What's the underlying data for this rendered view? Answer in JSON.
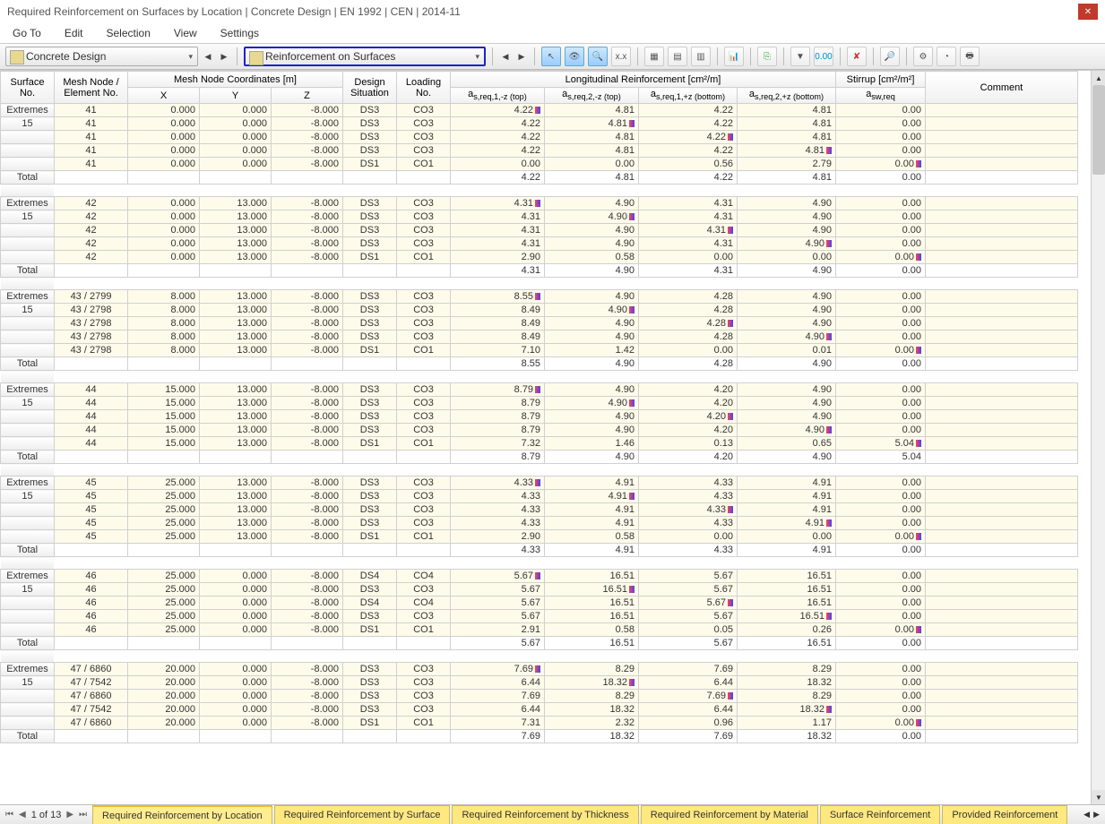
{
  "title": "Required Reinforcement on Surfaces by Location | Concrete Design | EN 1992 | CEN | 2014-11",
  "menu": [
    "Go To",
    "Edit",
    "Selection",
    "View",
    "Settings"
  ],
  "combo1": "Concrete Design",
  "combo2": "Reinforcement on Surfaces",
  "headers": {
    "surface": "Surface\nNo.",
    "mesh": "Mesh Node /\nElement No.",
    "coord_group": "Mesh Node Coordinates [m]",
    "x": "X",
    "y": "Y",
    "z": "Z",
    "ds": "Design\nSituation",
    "ln": "Loading\nNo.",
    "long_group": "Longitudinal Reinforcement [cm²/m]",
    "c1": "a",
    "c1s": "s,req,1,-z (top)",
    "c2": "a",
    "c2s": "s,req,2,-z (top)",
    "c3": "a",
    "c3s": "s,req,1,+z (bottom)",
    "c4": "a",
    "c4s": "s,req,2,+z (bottom)",
    "stirrup_group": "Stirrup [cm²/m²]",
    "sw": "a",
    "sws": "sw,req",
    "comment": "Comment"
  },
  "labels": {
    "extremes": "Extremes",
    "total": "Total",
    "surf15": "15"
  },
  "groups": [
    {
      "rows": [
        {
          "n": "41",
          "x": "0.000",
          "y": "0.000",
          "z": "-8.000",
          "ds": "DS3",
          "ln": "CO3",
          "a1": "4.22",
          "m1": 1,
          "a2": "4.81",
          "a3": "4.22",
          "a4": "4.81",
          "sw": "0.00"
        },
        {
          "n": "41",
          "x": "0.000",
          "y": "0.000",
          "z": "-8.000",
          "ds": "DS3",
          "ln": "CO3",
          "a1": "4.22",
          "a2": "4.81",
          "m2": 1,
          "a3": "4.22",
          "a4": "4.81",
          "sw": "0.00"
        },
        {
          "n": "41",
          "x": "0.000",
          "y": "0.000",
          "z": "-8.000",
          "ds": "DS3",
          "ln": "CO3",
          "a1": "4.22",
          "a2": "4.81",
          "a3": "4.22",
          "m3": 1,
          "a4": "4.81",
          "sw": "0.00"
        },
        {
          "n": "41",
          "x": "0.000",
          "y": "0.000",
          "z": "-8.000",
          "ds": "DS3",
          "ln": "CO3",
          "a1": "4.22",
          "a2": "4.81",
          "a3": "4.22",
          "a4": "4.81",
          "m4": 1,
          "sw": "0.00"
        },
        {
          "n": "41",
          "x": "0.000",
          "y": "0.000",
          "z": "-8.000",
          "ds": "DS1",
          "ln": "CO1",
          "a1": "0.00",
          "a2": "0.00",
          "a3": "0.56",
          "a4": "2.79",
          "sw": "0.00",
          "msw": 1
        }
      ],
      "tot": {
        "a1": "4.22",
        "a2": "4.81",
        "a3": "4.22",
        "a4": "4.81",
        "sw": "0.00"
      }
    },
    {
      "rows": [
        {
          "n": "42",
          "x": "0.000",
          "y": "13.000",
          "z": "-8.000",
          "ds": "DS3",
          "ln": "CO3",
          "a1": "4.31",
          "m1": 1,
          "a2": "4.90",
          "a3": "4.31",
          "a4": "4.90",
          "sw": "0.00"
        },
        {
          "n": "42",
          "x": "0.000",
          "y": "13.000",
          "z": "-8.000",
          "ds": "DS3",
          "ln": "CO3",
          "a1": "4.31",
          "a2": "4.90",
          "m2": 1,
          "a3": "4.31",
          "a4": "4.90",
          "sw": "0.00"
        },
        {
          "n": "42",
          "x": "0.000",
          "y": "13.000",
          "z": "-8.000",
          "ds": "DS3",
          "ln": "CO3",
          "a1": "4.31",
          "a2": "4.90",
          "a3": "4.31",
          "m3": 1,
          "a4": "4.90",
          "sw": "0.00"
        },
        {
          "n": "42",
          "x": "0.000",
          "y": "13.000",
          "z": "-8.000",
          "ds": "DS3",
          "ln": "CO3",
          "a1": "4.31",
          "a2": "4.90",
          "a3": "4.31",
          "a4": "4.90",
          "m4": 1,
          "sw": "0.00"
        },
        {
          "n": "42",
          "x": "0.000",
          "y": "13.000",
          "z": "-8.000",
          "ds": "DS1",
          "ln": "CO1",
          "a1": "2.90",
          "a2": "0.58",
          "a3": "0.00",
          "a4": "0.00",
          "sw": "0.00",
          "msw": 1
        }
      ],
      "tot": {
        "a1": "4.31",
        "a2": "4.90",
        "a3": "4.31",
        "a4": "4.90",
        "sw": "0.00"
      }
    },
    {
      "rows": [
        {
          "n": "43 / 2799",
          "x": "8.000",
          "y": "13.000",
          "z": "-8.000",
          "ds": "DS3",
          "ln": "CO3",
          "a1": "8.55",
          "m1": 1,
          "a2": "4.90",
          "a3": "4.28",
          "a4": "4.90",
          "sw": "0.00"
        },
        {
          "n": "43 / 2798",
          "x": "8.000",
          "y": "13.000",
          "z": "-8.000",
          "ds": "DS3",
          "ln": "CO3",
          "a1": "8.49",
          "a2": "4.90",
          "m2": 1,
          "a3": "4.28",
          "a4": "4.90",
          "sw": "0.00"
        },
        {
          "n": "43 / 2798",
          "x": "8.000",
          "y": "13.000",
          "z": "-8.000",
          "ds": "DS3",
          "ln": "CO3",
          "a1": "8.49",
          "a2": "4.90",
          "a3": "4.28",
          "m3": 1,
          "a4": "4.90",
          "sw": "0.00"
        },
        {
          "n": "43 / 2798",
          "x": "8.000",
          "y": "13.000",
          "z": "-8.000",
          "ds": "DS3",
          "ln": "CO3",
          "a1": "8.49",
          "a2": "4.90",
          "a3": "4.28",
          "a4": "4.90",
          "m4": 1,
          "sw": "0.00"
        },
        {
          "n": "43 / 2798",
          "x": "8.000",
          "y": "13.000",
          "z": "-8.000",
          "ds": "DS1",
          "ln": "CO1",
          "a1": "7.10",
          "a2": "1.42",
          "a3": "0.00",
          "a4": "0.01",
          "sw": "0.00",
          "msw": 1
        }
      ],
      "tot": {
        "a1": "8.55",
        "a2": "4.90",
        "a3": "4.28",
        "a4": "4.90",
        "sw": "0.00"
      }
    },
    {
      "rows": [
        {
          "n": "44",
          "x": "15.000",
          "y": "13.000",
          "z": "-8.000",
          "ds": "DS3",
          "ln": "CO3",
          "a1": "8.79",
          "m1": 1,
          "a2": "4.90",
          "a3": "4.20",
          "a4": "4.90",
          "sw": "0.00"
        },
        {
          "n": "44",
          "x": "15.000",
          "y": "13.000",
          "z": "-8.000",
          "ds": "DS3",
          "ln": "CO3",
          "a1": "8.79",
          "a2": "4.90",
          "m2": 1,
          "a3": "4.20",
          "a4": "4.90",
          "sw": "0.00"
        },
        {
          "n": "44",
          "x": "15.000",
          "y": "13.000",
          "z": "-8.000",
          "ds": "DS3",
          "ln": "CO3",
          "a1": "8.79",
          "a2": "4.90",
          "a3": "4.20",
          "m3": 1,
          "a4": "4.90",
          "sw": "0.00"
        },
        {
          "n": "44",
          "x": "15.000",
          "y": "13.000",
          "z": "-8.000",
          "ds": "DS3",
          "ln": "CO3",
          "a1": "8.79",
          "a2": "4.90",
          "a3": "4.20",
          "a4": "4.90",
          "m4": 1,
          "sw": "0.00"
        },
        {
          "n": "44",
          "x": "15.000",
          "y": "13.000",
          "z": "-8.000",
          "ds": "DS1",
          "ln": "CO1",
          "a1": "7.32",
          "a2": "1.46",
          "a3": "0.13",
          "a4": "0.65",
          "sw": "5.04",
          "msw": 1
        }
      ],
      "tot": {
        "a1": "8.79",
        "a2": "4.90",
        "a3": "4.20",
        "a4": "4.90",
        "sw": "5.04"
      }
    },
    {
      "rows": [
        {
          "n": "45",
          "x": "25.000",
          "y": "13.000",
          "z": "-8.000",
          "ds": "DS3",
          "ln": "CO3",
          "a1": "4.33",
          "m1": 1,
          "a2": "4.91",
          "a3": "4.33",
          "a4": "4.91",
          "sw": "0.00"
        },
        {
          "n": "45",
          "x": "25.000",
          "y": "13.000",
          "z": "-8.000",
          "ds": "DS3",
          "ln": "CO3",
          "a1": "4.33",
          "a2": "4.91",
          "m2": 1,
          "a3": "4.33",
          "a4": "4.91",
          "sw": "0.00"
        },
        {
          "n": "45",
          "x": "25.000",
          "y": "13.000",
          "z": "-8.000",
          "ds": "DS3",
          "ln": "CO3",
          "a1": "4.33",
          "a2": "4.91",
          "a3": "4.33",
          "m3": 1,
          "a4": "4.91",
          "sw": "0.00"
        },
        {
          "n": "45",
          "x": "25.000",
          "y": "13.000",
          "z": "-8.000",
          "ds": "DS3",
          "ln": "CO3",
          "a1": "4.33",
          "a2": "4.91",
          "a3": "4.33",
          "a4": "4.91",
          "m4": 1,
          "sw": "0.00"
        },
        {
          "n": "45",
          "x": "25.000",
          "y": "13.000",
          "z": "-8.000",
          "ds": "DS1",
          "ln": "CO1",
          "a1": "2.90",
          "a2": "0.58",
          "a3": "0.00",
          "a4": "0.00",
          "sw": "0.00",
          "msw": 1
        }
      ],
      "tot": {
        "a1": "4.33",
        "a2": "4.91",
        "a3": "4.33",
        "a4": "4.91",
        "sw": "0.00"
      }
    },
    {
      "rows": [
        {
          "n": "46",
          "x": "25.000",
          "y": "0.000",
          "z": "-8.000",
          "ds": "DS4",
          "ln": "CO4",
          "a1": "5.67",
          "m1": 1,
          "a2": "16.51",
          "a3": "5.67",
          "a4": "16.51",
          "sw": "0.00"
        },
        {
          "n": "46",
          "x": "25.000",
          "y": "0.000",
          "z": "-8.000",
          "ds": "DS3",
          "ln": "CO3",
          "a1": "5.67",
          "a2": "16.51",
          "m2": 1,
          "a3": "5.67",
          "a4": "16.51",
          "sw": "0.00"
        },
        {
          "n": "46",
          "x": "25.000",
          "y": "0.000",
          "z": "-8.000",
          "ds": "DS4",
          "ln": "CO4",
          "a1": "5.67",
          "a2": "16.51",
          "a3": "5.67",
          "m3": 1,
          "a4": "16.51",
          "sw": "0.00"
        },
        {
          "n": "46",
          "x": "25.000",
          "y": "0.000",
          "z": "-8.000",
          "ds": "DS3",
          "ln": "CO3",
          "a1": "5.67",
          "a2": "16.51",
          "a3": "5.67",
          "a4": "16.51",
          "m4": 1,
          "sw": "0.00"
        },
        {
          "n": "46",
          "x": "25.000",
          "y": "0.000",
          "z": "-8.000",
          "ds": "DS1",
          "ln": "CO1",
          "a1": "2.91",
          "a2": "0.58",
          "a3": "0.05",
          "a4": "0.26",
          "sw": "0.00",
          "msw": 1
        }
      ],
      "tot": {
        "a1": "5.67",
        "a2": "16.51",
        "a3": "5.67",
        "a4": "16.51",
        "sw": "0.00"
      }
    },
    {
      "rows": [
        {
          "n": "47 / 6860",
          "x": "20.000",
          "y": "0.000",
          "z": "-8.000",
          "ds": "DS3",
          "ln": "CO3",
          "a1": "7.69",
          "m1": 1,
          "a2": "8.29",
          "a3": "7.69",
          "a4": "8.29",
          "sw": "0.00"
        },
        {
          "n": "47 / 7542",
          "x": "20.000",
          "y": "0.000",
          "z": "-8.000",
          "ds": "DS3",
          "ln": "CO3",
          "a1": "6.44",
          "a2": "18.32",
          "m2": 1,
          "a3": "6.44",
          "a4": "18.32",
          "sw": "0.00"
        },
        {
          "n": "47 / 6860",
          "x": "20.000",
          "y": "0.000",
          "z": "-8.000",
          "ds": "DS3",
          "ln": "CO3",
          "a1": "7.69",
          "a2": "8.29",
          "a3": "7.69",
          "m3": 1,
          "a4": "8.29",
          "sw": "0.00"
        },
        {
          "n": "47 / 7542",
          "x": "20.000",
          "y": "0.000",
          "z": "-8.000",
          "ds": "DS3",
          "ln": "CO3",
          "a1": "6.44",
          "a2": "18.32",
          "a3": "6.44",
          "a4": "18.32",
          "m4": 1,
          "sw": "0.00"
        },
        {
          "n": "47 / 6860",
          "x": "20.000",
          "y": "0.000",
          "z": "-8.000",
          "ds": "DS1",
          "ln": "CO1",
          "a1": "7.31",
          "a2": "2.32",
          "a3": "0.96",
          "a4": "1.17",
          "sw": "0.00",
          "msw": 1
        }
      ],
      "tot": {
        "a1": "7.69",
        "a2": "18.32",
        "a3": "7.69",
        "a4": "18.32",
        "sw": "0.00"
      }
    }
  ],
  "pager": "1 of 13",
  "tabs": [
    "Required Reinforcement by Location",
    "Required Reinforcement by Surface",
    "Required Reinforcement by Thickness",
    "Required Reinforcement by Material",
    "Surface Reinforcement",
    "Provided Reinforcement"
  ]
}
